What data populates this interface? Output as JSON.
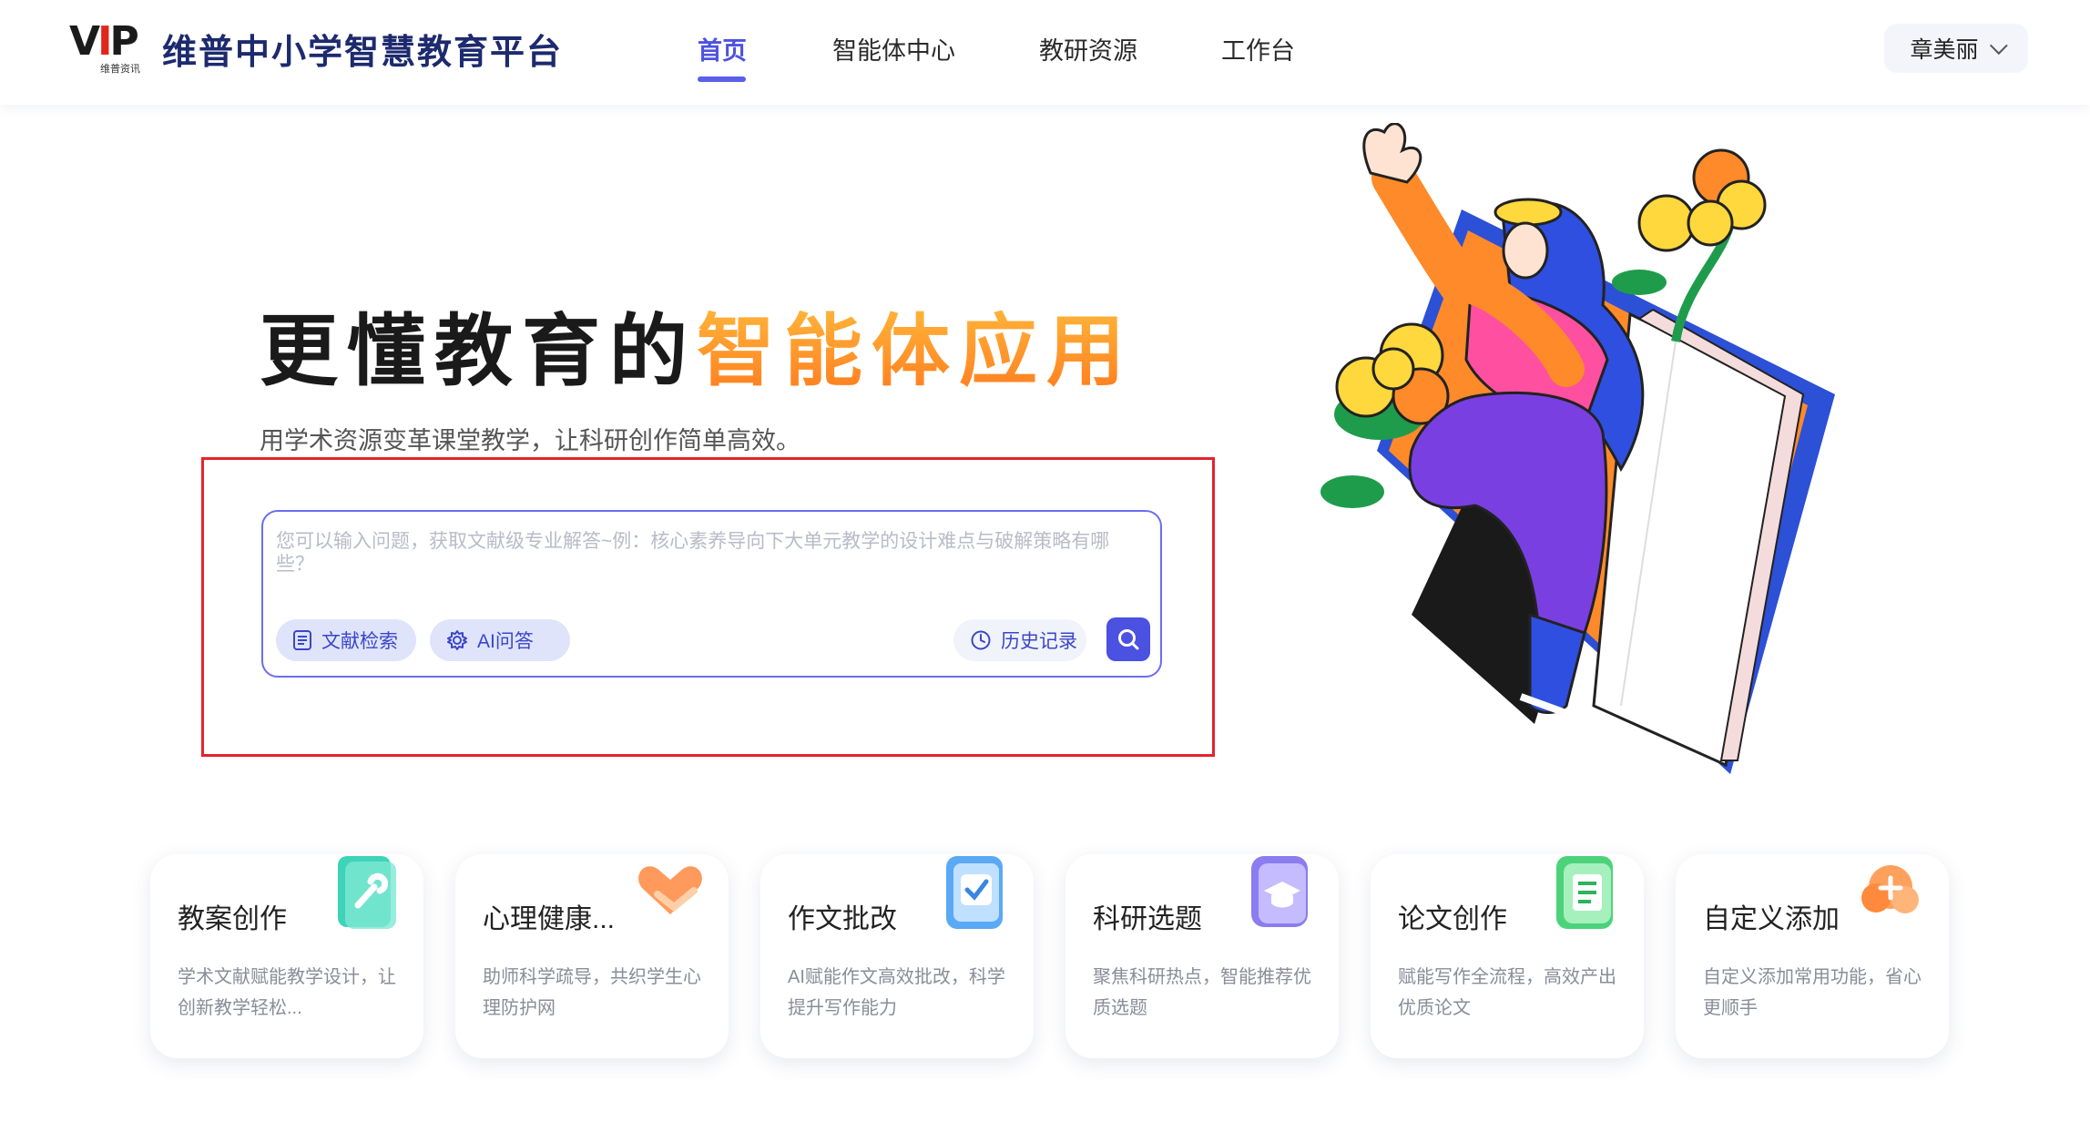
{
  "header": {
    "logo_text": "VIP",
    "logo_sub": "维普资讯",
    "brand": "维普中小学智慧教育平台",
    "nav": [
      {
        "label": "首页",
        "active": true
      },
      {
        "label": "智能体中心",
        "active": false
      },
      {
        "label": "教研资源",
        "active": false
      },
      {
        "label": "工作台",
        "active": false
      }
    ],
    "user": "章美丽"
  },
  "hero": {
    "headline_dark": "更懂教育的",
    "headline_accent": "智能体应用",
    "subline": "用学术资源变革课堂教学，让科研创作简单高效。"
  },
  "search": {
    "placeholder": "您可以输入问题，获取文献级专业解答~例：核心素养导向下大单元教学的设计难点与破解策略有哪些？",
    "doc_search": "文献检索",
    "ai_qa": "AI问答",
    "history": "历史记录"
  },
  "cards": [
    {
      "title": "教案创作",
      "desc": "学术文献赋能教学设计，让创新教学轻松...",
      "icon": "wrench-book-icon",
      "color": "#3fd3b8"
    },
    {
      "title": "心理健康...",
      "desc": "助师科学疏导，共织学生心理防护网",
      "icon": "heart-hands-icon",
      "color": "#ff9a5c"
    },
    {
      "title": "作文批改",
      "desc": "AI赋能作文高效批改，科学提升写作能力",
      "icon": "check-clipboard-icon",
      "color": "#5aa9f5"
    },
    {
      "title": "科研选题",
      "desc": "聚焦科研热点，智能推荐优质选题",
      "icon": "graduation-cap-icon",
      "color": "#8b7cf0"
    },
    {
      "title": "论文创作",
      "desc": "赋能写作全流程，高效产出优质论文",
      "icon": "document-icon",
      "color": "#4cd37a"
    },
    {
      "title": "自定义添加",
      "desc": "自定义添加常用功能，省心更顺手",
      "icon": "plus-cloud-icon",
      "color": "#ffa15c"
    }
  ]
}
